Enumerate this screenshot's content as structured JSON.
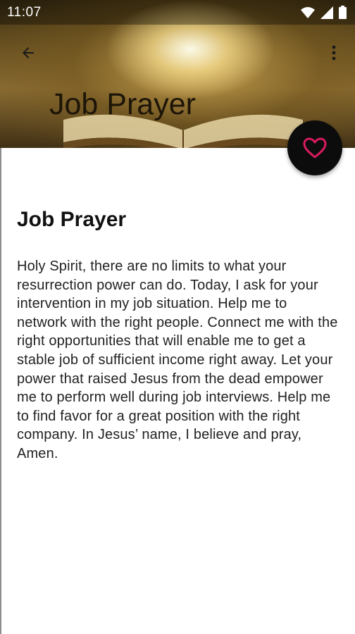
{
  "status_bar": {
    "time": "11:07",
    "icons": [
      "wifi-icon",
      "signal-icon",
      "battery-icon"
    ]
  },
  "toolbar": {
    "back_icon": "arrow-left-icon",
    "menu_icon": "more-vertical-icon",
    "header_title": "Job Prayer"
  },
  "fab": {
    "icon": "heart-outline-icon",
    "icon_color": "#d81b60",
    "background": "#0c0c0c"
  },
  "prayer": {
    "title": "Job Prayer",
    "body": "Holy Spirit, there are no limits to what your resurrection power can do. Today, I ask for your intervention in my job situation. Help me to network with the right people. Connect me with the right opportunities that will enable me to get a stable job of sufficient income right away. Let your power that raised Jesus from the dead empower me to perform well during job interviews. Help me to find favor for a great position with the right company. In Jesus’ name, I believe and pray, Amen."
  }
}
